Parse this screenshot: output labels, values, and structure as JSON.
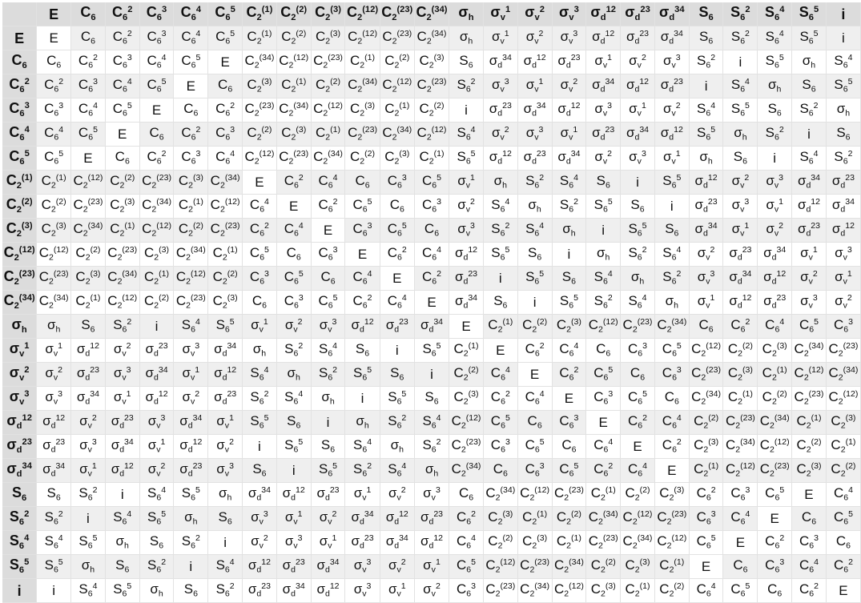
{
  "title": "",
  "headers": [
    "E",
    "C6",
    "C6^2",
    "C6^3",
    "C6^4",
    "C6^5",
    "C2^(1)",
    "C2^(2)",
    "C2^(3)",
    "C2^(12)",
    "C2^(23)",
    "C2^(34)",
    "σh",
    "σv^1",
    "σv^2",
    "σv^3",
    "σd^12",
    "σd^23",
    "σd^34",
    "S6",
    "S6^2",
    "S6^4",
    "S6^5",
    "i"
  ],
  "rows": [
    [
      "E",
      "C6",
      "C6^2",
      "C6^3",
      "C6^4",
      "C6^5",
      "C2^(1)",
      "C2^(2)",
      "C2^(3)",
      "C2^(12)",
      "C2^(23)",
      "C2^(34)",
      "σh",
      "σv^1",
      "σv^2",
      "σv^3",
      "σd^12",
      "σd^23",
      "σd^34",
      "S6",
      "S6^2",
      "S6^4",
      "S6^5",
      "i"
    ],
    [
      "C6",
      "C6^2",
      "C6^3",
      "C6^4",
      "C6^5",
      "E",
      "C2^(34)",
      "C2^(12)",
      "C2^(23)",
      "C2^(1)",
      "C2^(2)",
      "C2^(3)",
      "S6",
      "σd^34",
      "σd^12",
      "σd^23",
      "σv^1",
      "σv^2",
      "σv^3",
      "S6^2",
      "i",
      "S6^5",
      "σh",
      "S6^4"
    ],
    [
      "C6^2",
      "C6^3",
      "C6^4",
      "C6^5",
      "E",
      "C6",
      "C2^(3)",
      "C2^(1)",
      "C2^(2)",
      "C2^(34)",
      "C2^(12)",
      "C2^(23)",
      "S6^2",
      "σv^3",
      "σv^1",
      "σv^2",
      "σd^34",
      "σd^12",
      "σd^23",
      "i",
      "S6^4",
      "σh",
      "S6",
      "S6^5"
    ],
    [
      "C6^3",
      "C6^4",
      "C6^5",
      "E",
      "C6",
      "C6^2",
      "C2^(23)",
      "C2^(34)",
      "C2^(12)",
      "C2^(3)",
      "C2^(1)",
      "C2^(2)",
      "i",
      "σd^23",
      "σd^34",
      "σd^12",
      "σv^3",
      "σv^1",
      "σv^2",
      "S6^4",
      "S6^5",
      "S6",
      "S6^2",
      "σh"
    ],
    [
      "C6^4",
      "C6^5",
      "E",
      "C6",
      "C6^2",
      "C6^3",
      "C2^(2)",
      "C2^(3)",
      "C2^(1)",
      "C2^(23)",
      "C2^(34)",
      "C2^(12)",
      "S6^4",
      "σv^2",
      "σv^3",
      "σv^1",
      "σd^23",
      "σd^34",
      "σd^12",
      "S6^5",
      "σh",
      "S6^2",
      "i",
      "S6"
    ],
    [
      "C6^5",
      "E",
      "C6",
      "C6^2",
      "C6^3",
      "C6^4",
      "C2^(12)",
      "C2^(23)",
      "C2^(34)",
      "C2^(2)",
      "C2^(3)",
      "C2^(1)",
      "S6^5",
      "σd^12",
      "σd^23",
      "σd^34",
      "σv^2",
      "σv^3",
      "σv^1",
      "σh",
      "S6",
      "i",
      "S6^4",
      "S6^2"
    ],
    [
      "C2^(1)",
      "C2^(12)",
      "C2^(2)",
      "C2^(23)",
      "C2^(3)",
      "C2^(34)",
      "E",
      "C6^2",
      "C6^4",
      "C6",
      "C6^3",
      "C6^5",
      "σv^1",
      "σh",
      "S6^2",
      "S6^4",
      "S6",
      "i",
      "S6^5",
      "σd^12",
      "σv^2",
      "σv^3",
      "σd^34",
      "σd^23"
    ],
    [
      "C2^(2)",
      "C2^(23)",
      "C2^(3)",
      "C2^(34)",
      "C2^(1)",
      "C2^(12)",
      "C6^4",
      "E",
      "C6^2",
      "C6^5",
      "C6",
      "C6^3",
      "σv^2",
      "S6^4",
      "σh",
      "S6^2",
      "S6^5",
      "S6",
      "i",
      "σd^23",
      "σv^3",
      "σv^1",
      "σd^12",
      "σd^34"
    ],
    [
      "C2^(3)",
      "C2^(34)",
      "C2^(1)",
      "C2^(12)",
      "C2^(2)",
      "C2^(23)",
      "C6^2",
      "C6^4",
      "E",
      "C6^3",
      "C6^5",
      "C6",
      "σv^3",
      "S6^2",
      "S6^4",
      "σh",
      "i",
      "S6^5",
      "S6",
      "σd^34",
      "σv^1",
      "σv^2",
      "σd^23",
      "σd^12"
    ],
    [
      "C2^(12)",
      "C2^(2)",
      "C2^(23)",
      "C2^(3)",
      "C2^(34)",
      "C2^(1)",
      "C6^5",
      "C6",
      "C6^3",
      "E",
      "C6^2",
      "C6^4",
      "σd^12",
      "S6^5",
      "S6",
      "i",
      "σh",
      "S6^2",
      "S6^4",
      "σv^2",
      "σd^23",
      "σd^34",
      "σv^1",
      "σv^3"
    ],
    [
      "C2^(23)",
      "C2^(3)",
      "C2^(34)",
      "C2^(1)",
      "C2^(12)",
      "C2^(2)",
      "C6^3",
      "C6^5",
      "C6",
      "C6^4",
      "E",
      "C6^2",
      "σd^23",
      "i",
      "S6^5",
      "S6",
      "S6^4",
      "σh",
      "S6^2",
      "σv^3",
      "σd^34",
      "σd^12",
      "σv^2",
      "σv^1"
    ],
    [
      "C2^(34)",
      "C2^(1)",
      "C2^(12)",
      "C2^(2)",
      "C2^(23)",
      "C2^(3)",
      "C6",
      "C6^3",
      "C6^5",
      "C6^2",
      "C6^4",
      "E",
      "σd^34",
      "S6",
      "i",
      "S6^5",
      "S6^2",
      "S6^4",
      "σh",
      "σv^1",
      "σd^12",
      "σd^23",
      "σv^3",
      "σv^2"
    ],
    [
      "σh",
      "S6",
      "S6^2",
      "i",
      "S6^4",
      "S6^5",
      "σv^1",
      "σv^2",
      "σv^3",
      "σd^12",
      "σd^23",
      "σd^34",
      "E",
      "C2^(1)",
      "C2^(2)",
      "C2^(3)",
      "C2^(12)",
      "C2^(23)",
      "C2^(34)",
      "C6",
      "C6^2",
      "C6^4",
      "C6^5",
      "C6^3"
    ],
    [
      "σv^1",
      "σd^12",
      "σv^2",
      "σd^23",
      "σv^3",
      "σd^34",
      "σh",
      "S6^2",
      "S6^4",
      "S6",
      "i",
      "S6^5",
      "C2^(1)",
      "E",
      "C6^2",
      "C6^4",
      "C6",
      "C6^3",
      "C6^5",
      "C2^(12)",
      "C2^(2)",
      "C2^(3)",
      "C2^(34)",
      "C2^(23)"
    ],
    [
      "σv^2",
      "σd^23",
      "σv^3",
      "σd^34",
      "σv^1",
      "σd^12",
      "S6^4",
      "σh",
      "S6^2",
      "S6^5",
      "S6",
      "i",
      "C2^(2)",
      "C6^4",
      "E",
      "C6^2",
      "C6^5",
      "C6",
      "C6^3",
      "C2^(23)",
      "C2^(3)",
      "C2^(1)",
      "C2^(12)",
      "C2^(34)"
    ],
    [
      "σv^3",
      "σd^34",
      "σv^1",
      "σd^12",
      "σv^2",
      "σd^23",
      "S6^2",
      "S6^4",
      "σh",
      "i",
      "S6^5",
      "S6",
      "C2^(3)",
      "C6^2",
      "C6^4",
      "E",
      "C6^3",
      "C6^5",
      "C6",
      "C2^(34)",
      "C2^(1)",
      "C2^(2)",
      "C2^(23)",
      "C2^(12)"
    ],
    [
      "σd^12",
      "σv^2",
      "σd^23",
      "σv^3",
      "σd^34",
      "σv^1",
      "S6^5",
      "S6",
      "i",
      "σh",
      "S6^2",
      "S6^4",
      "C2^(12)",
      "C6^5",
      "C6",
      "C6^3",
      "E",
      "C6^2",
      "C6^4",
      "C2^(2)",
      "C2^(23)",
      "C2^(34)",
      "C2^(1)",
      "C2^(3)"
    ],
    [
      "σd^23",
      "σv^3",
      "σd^34",
      "σv^1",
      "σd^12",
      "σv^2",
      "i",
      "S6^5",
      "S6",
      "S6^4",
      "σh",
      "S6^2",
      "C2^(23)",
      "C6^3",
      "C6^5",
      "C6",
      "C6^4",
      "E",
      "C6^2",
      "C2^(3)",
      "C2^(34)",
      "C2^(12)",
      "C2^(2)",
      "C2^(1)"
    ],
    [
      "σd^34",
      "σv^1",
      "σd^12",
      "σv^2",
      "σd^23",
      "σv^3",
      "S6",
      "i",
      "S6^5",
      "S6^2",
      "S6^4",
      "σh",
      "C2^(34)",
      "C6",
      "C6^3",
      "C6^5",
      "C6^2",
      "C6^4",
      "E",
      "C2^(1)",
      "C2^(12)",
      "C2^(23)",
      "C2^(3)",
      "C2^(2)"
    ],
    [
      "S6",
      "S6^2",
      "i",
      "S6^4",
      "S6^5",
      "σh",
      "σd^34",
      "σd^12",
      "σd^23",
      "σv^1",
      "σv^2",
      "σv^3",
      "C6",
      "C2^(34)",
      "C2^(12)",
      "C2^(23)",
      "C2^(1)",
      "C2^(2)",
      "C2^(3)",
      "C6^2",
      "C6^3",
      "C6^5",
      "E",
      "C6^4"
    ],
    [
      "S6^2",
      "i",
      "S6^4",
      "S6^5",
      "σh",
      "S6",
      "σv^3",
      "σv^1",
      "σv^2",
      "σd^34",
      "σd^12",
      "σd^23",
      "C6^2",
      "C2^(3)",
      "C2^(1)",
      "C2^(2)",
      "C2^(34)",
      "C2^(12)",
      "C2^(23)",
      "C6^3",
      "C6^4",
      "E",
      "C6",
      "C6^5"
    ],
    [
      "S6^4",
      "S6^5",
      "σh",
      "S6",
      "S6^2",
      "i",
      "σv^2",
      "σv^3",
      "σv^1",
      "σd^23",
      "σd^34",
      "σd^12",
      "C6^4",
      "C2^(2)",
      "C2^(3)",
      "C2^(1)",
      "C2^(23)",
      "C2^(34)",
      "C2^(12)",
      "C6^5",
      "E",
      "C6^2",
      "C6^3",
      "C6"
    ],
    [
      "S6^5",
      "σh",
      "S6",
      "S6^2",
      "i",
      "S6^4",
      "σd^12",
      "σd^23",
      "σd^34",
      "σv^3",
      "σv^2",
      "σv^1",
      "C6^5",
      "C2^(12)",
      "C2^(23)",
      "C2^(34)",
      "C2^(2)",
      "C2^(3)",
      "C2^(1)",
      "E",
      "C6",
      "C6^3",
      "C6^4",
      "C6^2"
    ],
    [
      "i",
      "S6^4",
      "S6^5",
      "σh",
      "S6",
      "S6^2",
      "σd^23",
      "σd^34",
      "σd^12",
      "σv^3",
      "σv^1",
      "σv^2",
      "C6^3",
      "C2^(23)",
      "C2^(34)",
      "C2^(12)",
      "C2^(3)",
      "C2^(1)",
      "C2^(2)",
      "C6^4",
      "C6^5",
      "C6",
      "C6^2",
      "E"
    ]
  ]
}
